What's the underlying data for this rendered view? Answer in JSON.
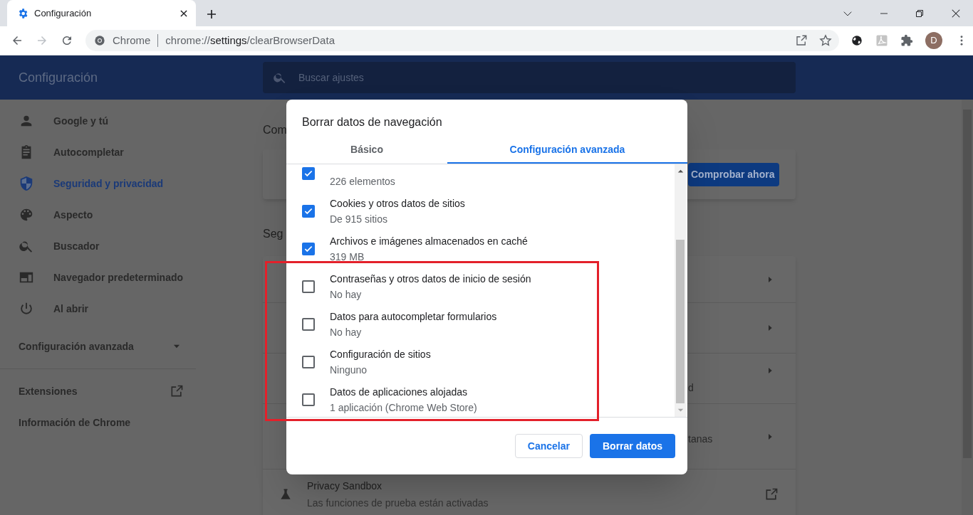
{
  "browser": {
    "tab": {
      "title": "Configuración"
    },
    "omnibox": {
      "site_label": "Chrome",
      "url": "chrome://**settings**/clearBrowserData"
    },
    "profile_initial": "D"
  },
  "header": {
    "title": "Configuración",
    "search": {
      "placeholder": "Buscar ajustes"
    }
  },
  "sidebar": {
    "items": [
      {
        "label": "Google y tú",
        "selected": false
      },
      {
        "label": "Autocompletar",
        "selected": false
      },
      {
        "label": "Seguridad y privacidad",
        "selected": true
      },
      {
        "label": "Aspecto",
        "selected": false
      },
      {
        "label": "Buscador",
        "selected": false
      },
      {
        "label": "Navegador predeterminado",
        "selected": false
      },
      {
        "label": "Al abrir",
        "selected": false
      }
    ],
    "advanced": {
      "label": "Configuración avanzada",
      "expanded": false
    },
    "links": [
      {
        "label": "Extensiones",
        "external": true
      },
      {
        "label": "Información de Chrome",
        "external": false
      }
    ]
  },
  "main": {
    "section_1": {
      "heading": "Com",
      "button": "Comprobar ahora"
    },
    "section_2": {
      "heading": "Seg",
      "rows": [
        {
          "text": ""
        },
        {
          "text": ""
        },
        {
          "text": "d"
        },
        {
          "text": "tanas"
        }
      ],
      "last_row": {
        "title": "Privacy Sandbox",
        "subtitle": "Las funciones de prueba están activadas"
      }
    }
  },
  "dialog": {
    "title": "Borrar datos de navegación",
    "tabs": [
      {
        "label": "Básico",
        "selected": false
      },
      {
        "label": "Configuración avanzada",
        "selected": true
      }
    ],
    "options": [
      {
        "detail": "226 elementos",
        "checked": true
      },
      {
        "title": "Cookies y otros datos de sitios",
        "detail": "De 915 sitios",
        "checked": true
      },
      {
        "title": "Archivos e imágenes almacenados en caché",
        "detail": "319 MB",
        "checked": true
      },
      {
        "title": "Contraseñas y otros datos de inicio de sesión",
        "detail": "No hay",
        "checked": false
      },
      {
        "title": "Datos para autocompletar formularios",
        "detail": "No hay",
        "checked": false
      },
      {
        "title": "Configuración de sitios",
        "detail": "Ninguno",
        "checked": false
      },
      {
        "title": "Datos de aplicaciones alojadas",
        "detail": "1 aplicación (Chrome Web Store)",
        "checked": false
      }
    ],
    "buttons": [
      {
        "label": "Cancelar",
        "kind": "secondary"
      },
      {
        "label": "Borrar datos",
        "kind": "primary"
      }
    ]
  }
}
